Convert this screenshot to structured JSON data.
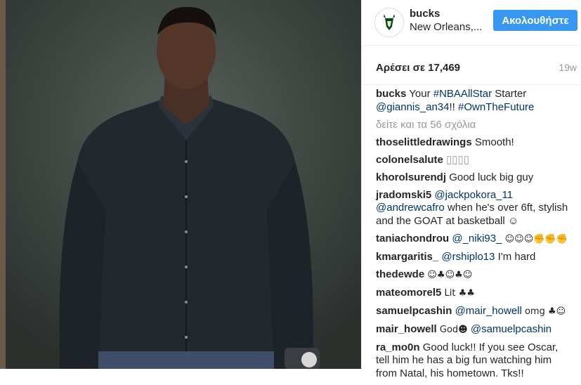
{
  "header": {
    "username": "bucks",
    "location": "New Orleans,...",
    "follow_label": "Ακολουθήστε",
    "avatar_icon": "bucks-deer-logo-icon"
  },
  "meta": {
    "likes": "Αρέσει σε 17,469",
    "time": "19w"
  },
  "caption": {
    "user": "bucks",
    "text1": "Your ",
    "tag1": "#NBAAllStar",
    "text2": " Starter ",
    "mention": "@giannis_an34",
    "text3": "!! ",
    "tag2": "#OwnTheFuture"
  },
  "view_all": "δείτε και τα 56 σχόλια",
  "comments": [
    {
      "user": "thoselittledrawings",
      "text": "Smooth!"
    },
    {
      "user": "colonelsalute",
      "text": "▯▯▯▯"
    },
    {
      "user": "khorolsurendj",
      "text": "Good luck big guy"
    },
    {
      "user": "jradomski5",
      "mention1": "@jackpokora_11",
      "mention2": "@andrewcafro",
      "text": " when he's over 6ft, stylish and the GOAT at basketball ☺"
    },
    {
      "user": "taniachondrou",
      "mention": "@_niki93_",
      "text": " ☺☺☺✊✊✊"
    },
    {
      "user": "kmargaritis_",
      "mention": "@rshiplo13",
      "text": " I'm hard"
    },
    {
      "user": "thedewde",
      "text": "☺♣☺♣☺"
    },
    {
      "user": "mateomorel5",
      "text": "Lit ♣♣"
    },
    {
      "user": "samuelpcashin",
      "mention": "@mair_howell",
      "text": " omg ♣☺"
    },
    {
      "user": "mair_howell",
      "text": "God☻ ",
      "mention": "@samuelpcashin"
    },
    {
      "user": "ra_mo0n",
      "text": "Good luck!! If you see Oscar, tell him he has a big fun watching him from Natal, his hometown. Tks!!"
    }
  ],
  "colors": {
    "follow_bg": "#3897f0",
    "link": "#003569",
    "muted": "#999999"
  }
}
